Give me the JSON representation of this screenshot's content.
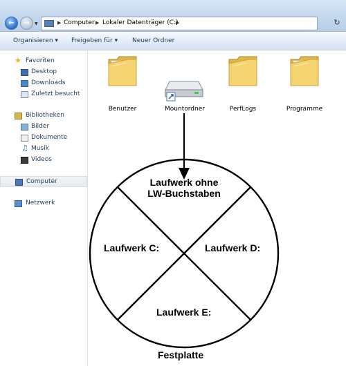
{
  "address": {
    "crumbs": [
      "Computer",
      "Lokaler Datenträger (C:)"
    ]
  },
  "toolbar": {
    "organize_label": "Organisieren",
    "share_label": "Freigeben für",
    "new_folder_label": "Neuer Ordner"
  },
  "sidebar": {
    "favorites_label": "Favoriten",
    "desktop_label": "Desktop",
    "downloads_label": "Downloads",
    "recent_label": "Zuletzt besucht",
    "libraries_label": "Bibliotheken",
    "pictures_label": "Bilder",
    "documents_label": "Dokumente",
    "music_label": "Musik",
    "videos_label": "Videos",
    "computer_label": "Computer",
    "network_label": "Netzwerk"
  },
  "files": [
    "Benutzer",
    "Mountordner",
    "PerfLogs",
    "Programme"
  ],
  "diagram": {
    "top_line1": "Laufwerk ohne",
    "top_line2": "LW-Buchstaben",
    "left_label": "Laufwerk C:",
    "right_label": "Laufwerk D:",
    "bottom_label": "Laufwerk E:",
    "caption": "Festplatte"
  }
}
